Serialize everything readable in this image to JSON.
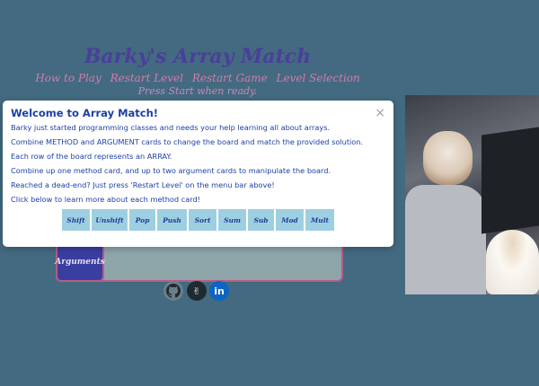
{
  "header": {
    "title": "Barky's Array Match",
    "menu": [
      "How to Play",
      "Restart Level",
      "Restart Game",
      "Level Selection"
    ],
    "subtitle": "Press Start when ready."
  },
  "board": {
    "arguments_label": "Arguments"
  },
  "social": {
    "github_icon": "github-icon",
    "victory_icon": "peace-hand-icon",
    "linkedin_icon": "linkedin-icon",
    "linkedin_label": "in"
  },
  "modal": {
    "title": "Welcome to Array Match!",
    "close_label": "×",
    "lines": [
      "Barky just started programming classes and needs your help learning all about arrays.",
      "Combine METHOD and ARGUMENT cards to change the board and match the provided solution.",
      "Each row of the board represents an ARRAY.",
      "Combine up one method card, and up to two argument cards to manipulate the board.",
      "Reached a dead-end? Just press 'Restart Level' on the menu bar above!",
      "Click below to learn more about each method card!"
    ],
    "methods": [
      "Shift",
      "Unshift",
      "Pop",
      "Push",
      "Sort",
      "Sum",
      "Sub",
      "Mod",
      "Mult"
    ]
  },
  "colors": {
    "background": "#436a80",
    "title": "#4a3f9a",
    "menu": "#d77aa8",
    "modal_text": "#1d3fa5",
    "card": "#9ecfe0"
  }
}
